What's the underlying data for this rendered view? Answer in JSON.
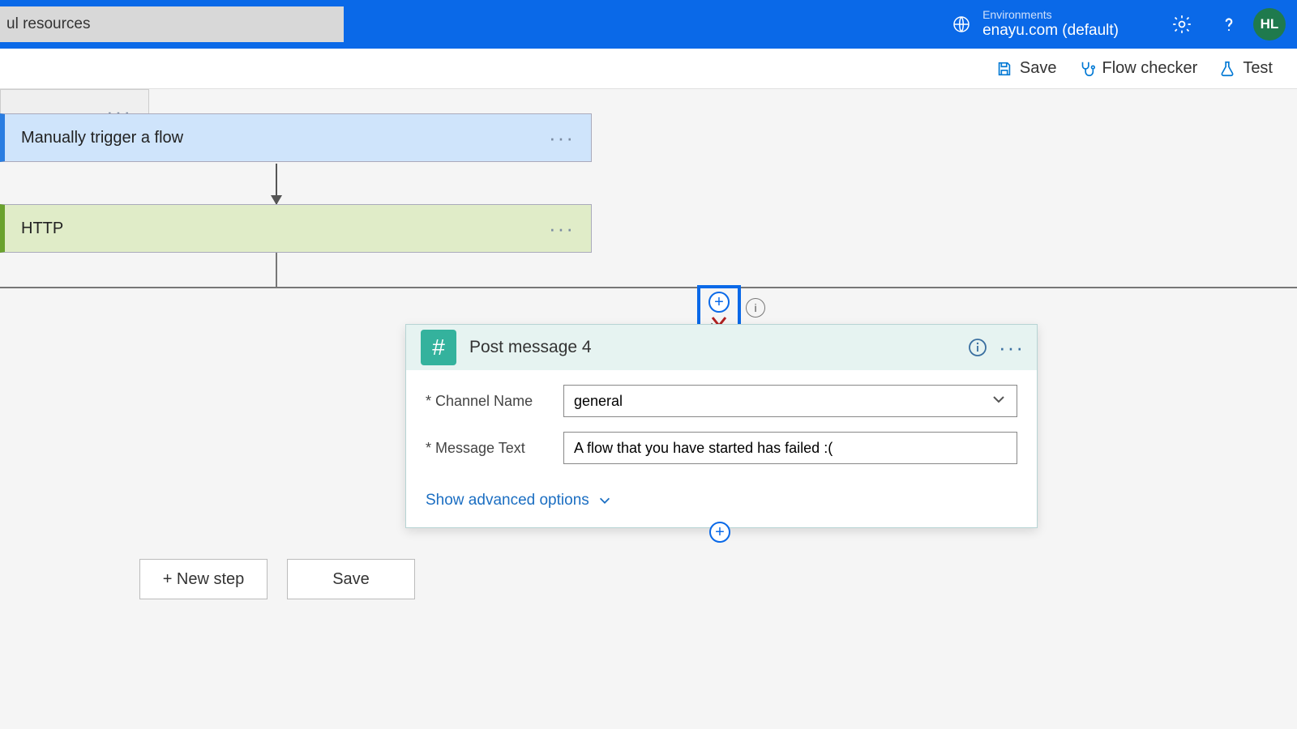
{
  "header": {
    "search_value": "ul resources",
    "environments_label": "Environments",
    "environment_name": "enayu.com (default)",
    "avatar_initials": "HL"
  },
  "toolbar": {
    "save_label": "Save",
    "flow_checker_label": "Flow checker",
    "test_label": "Test"
  },
  "flow": {
    "trigger_title": "Manually trigger a flow",
    "http_title": "HTTP",
    "post_message": {
      "title": "Post message 4",
      "channel_label": "* Channel Name",
      "channel_value": "general",
      "message_label": "* Message Text",
      "message_value": "A flow that you have started has failed :(",
      "advanced_label": "Show advanced options"
    }
  },
  "buttons": {
    "new_step": "+ New step",
    "save": "Save"
  }
}
